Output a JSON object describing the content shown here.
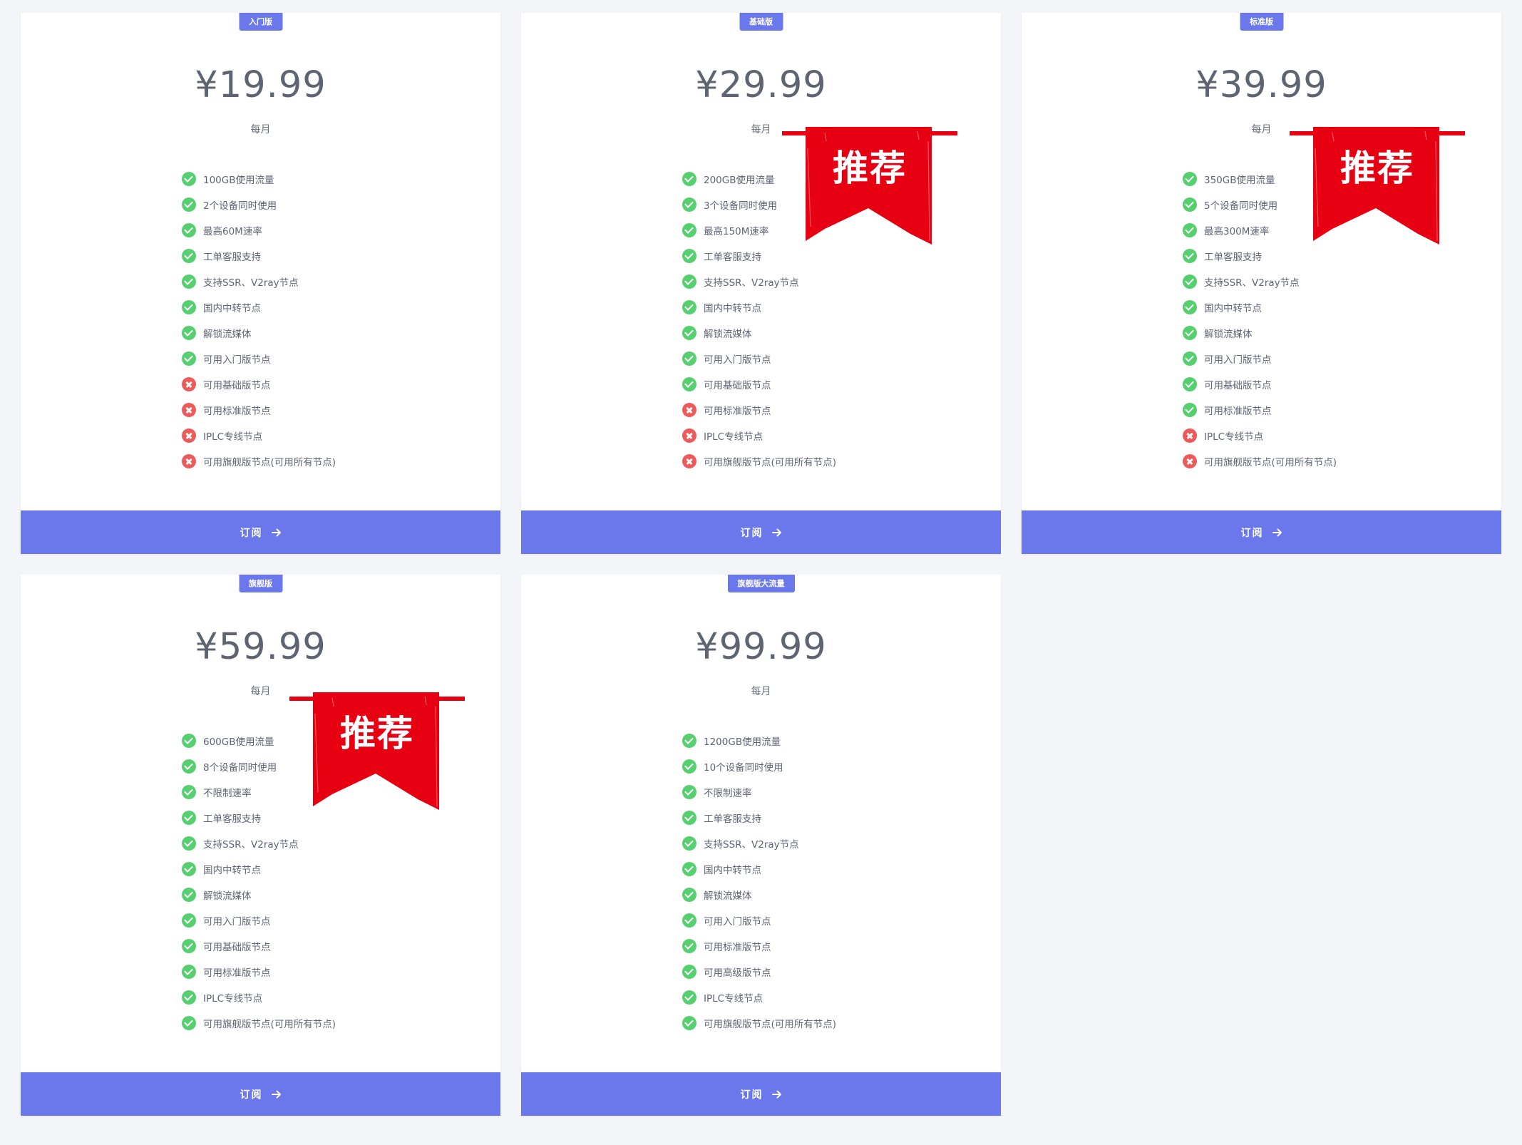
{
  "ribbon": {
    "label": "推荐",
    "color": "#e60012"
  },
  "colors": {
    "accent": "#6a78ec",
    "check": "#56cf6f",
    "cross": "#ee5a5a",
    "background": "#f4f5f9"
  },
  "plans": [
    {
      "badge": "入门版",
      "price": "¥19.99",
      "period": "每月",
      "recommended": false,
      "subscribe_label": "订阅",
      "features": [
        {
          "text": "100GB使用流量",
          "included": true
        },
        {
          "text": "2个设备同时使用",
          "included": true
        },
        {
          "text": "最高60M速率",
          "included": true
        },
        {
          "text": "工单客服支持",
          "included": true
        },
        {
          "text": "支持SSR、V2ray节点",
          "included": true
        },
        {
          "text": "国内中转节点",
          "included": true
        },
        {
          "text": "解锁流媒体",
          "included": true
        },
        {
          "text": "可用入门版节点",
          "included": true
        },
        {
          "text": "可用基础版节点",
          "included": false
        },
        {
          "text": "可用标准版节点",
          "included": false
        },
        {
          "text": "IPLC专线节点",
          "included": false
        },
        {
          "text": "可用旗舰版节点(可用所有节点)",
          "included": false
        }
      ]
    },
    {
      "badge": "基础版",
      "price": "¥29.99",
      "period": "每月",
      "recommended": true,
      "subscribe_label": "订阅",
      "features": [
        {
          "text": "200GB使用流量",
          "included": true
        },
        {
          "text": "3个设备同时使用",
          "included": true
        },
        {
          "text": "最高150M速率",
          "included": true
        },
        {
          "text": "工单客服支持",
          "included": true
        },
        {
          "text": "支持SSR、V2ray节点",
          "included": true
        },
        {
          "text": "国内中转节点",
          "included": true
        },
        {
          "text": "解锁流媒体",
          "included": true
        },
        {
          "text": "可用入门版节点",
          "included": true
        },
        {
          "text": "可用基础版节点",
          "included": true
        },
        {
          "text": "可用标准版节点",
          "included": false
        },
        {
          "text": "IPLC专线节点",
          "included": false
        },
        {
          "text": "可用旗舰版节点(可用所有节点)",
          "included": false
        }
      ]
    },
    {
      "badge": "标准版",
      "price": "¥39.99",
      "period": "每月",
      "recommended": true,
      "subscribe_label": "订阅",
      "features": [
        {
          "text": "350GB使用流量",
          "included": true
        },
        {
          "text": "5个设备同时使用",
          "included": true
        },
        {
          "text": "最高300M速率",
          "included": true
        },
        {
          "text": "工单客服支持",
          "included": true
        },
        {
          "text": "支持SSR、V2ray节点",
          "included": true
        },
        {
          "text": "国内中转节点",
          "included": true
        },
        {
          "text": "解锁流媒体",
          "included": true
        },
        {
          "text": "可用入门版节点",
          "included": true
        },
        {
          "text": "可用基础版节点",
          "included": true
        },
        {
          "text": "可用标准版节点",
          "included": true
        },
        {
          "text": "IPLC专线节点",
          "included": false
        },
        {
          "text": "可用旗舰版节点(可用所有节点)",
          "included": false
        }
      ]
    },
    {
      "badge": "旗舰版",
      "price": "¥59.99",
      "period": "每月",
      "recommended": true,
      "subscribe_label": "订阅",
      "features": [
        {
          "text": "600GB使用流量",
          "included": true
        },
        {
          "text": "8个设备同时使用",
          "included": true
        },
        {
          "text": "不限制速率",
          "included": true
        },
        {
          "text": "工单客服支持",
          "included": true
        },
        {
          "text": "支持SSR、V2ray节点",
          "included": true
        },
        {
          "text": "国内中转节点",
          "included": true
        },
        {
          "text": "解锁流媒体",
          "included": true
        },
        {
          "text": "可用入门版节点",
          "included": true
        },
        {
          "text": "可用基础版节点",
          "included": true
        },
        {
          "text": "可用标准版节点",
          "included": true
        },
        {
          "text": "IPLC专线节点",
          "included": true
        },
        {
          "text": "可用旗舰版节点(可用所有节点)",
          "included": true
        }
      ]
    },
    {
      "badge": "旗舰版大流量",
      "price": "¥99.99",
      "period": "每月",
      "recommended": false,
      "subscribe_label": "订阅",
      "features": [
        {
          "text": "1200GB使用流量",
          "included": true
        },
        {
          "text": "10个设备同时使用",
          "included": true
        },
        {
          "text": "不限制速率",
          "included": true
        },
        {
          "text": "工单客服支持",
          "included": true
        },
        {
          "text": "支持SSR、V2ray节点",
          "included": true
        },
        {
          "text": "国内中转节点",
          "included": true
        },
        {
          "text": "解锁流媒体",
          "included": true
        },
        {
          "text": "可用入门版节点",
          "included": true
        },
        {
          "text": "可用标准版节点",
          "included": true
        },
        {
          "text": "可用高级版节点",
          "included": true
        },
        {
          "text": "IPLC专线节点",
          "included": true
        },
        {
          "text": "可用旗舰版节点(可用所有节点)",
          "included": true
        }
      ]
    }
  ]
}
